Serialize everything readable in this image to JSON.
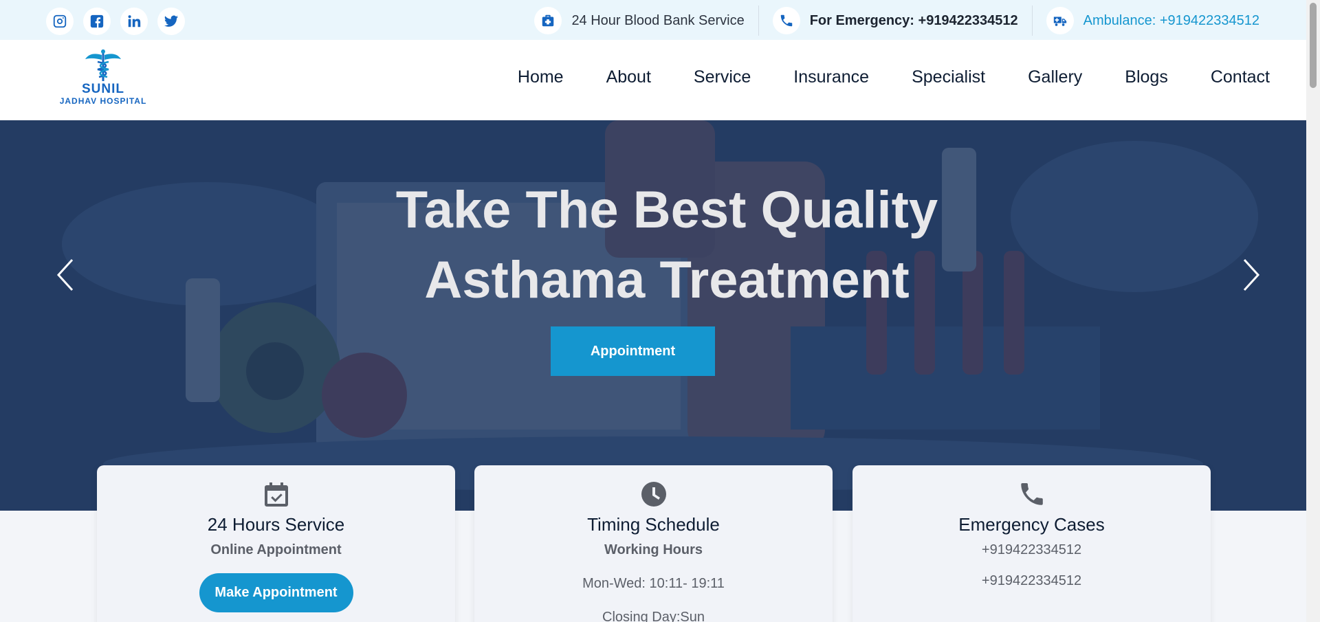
{
  "topbar": {
    "social": [
      {
        "icon": "instagram-icon"
      },
      {
        "icon": "facebook-icon"
      },
      {
        "icon": "linkedin-icon"
      },
      {
        "icon": "twitter-icon"
      }
    ],
    "blood_bank": "24 Hour Blood Bank Service",
    "emergency": "For Emergency: +919422334512",
    "ambulance": "Ambulance: +919422334512"
  },
  "logo": {
    "line1": "SUNIL",
    "line2": "JADHAV HOSPITAL"
  },
  "nav": [
    "Home",
    "About",
    "Service",
    "Insurance",
    "Specialist",
    "Gallery",
    "Blogs",
    "Contact"
  ],
  "hero": {
    "title_line1": "Take The Best Quality",
    "title_line2": "Asthama Treatment",
    "button": "Appointment"
  },
  "cards": [
    {
      "icon": "calendar-check-icon",
      "title": "24 Hours Service",
      "subtitle": "Online Appointment",
      "button": "Make Appointment"
    },
    {
      "icon": "clock-icon",
      "title": "Timing Schedule",
      "subtitle": "Working Hours",
      "line1": "Mon-Wed: 10:11- 19:11",
      "line2": "Closing Day:Sun"
    },
    {
      "icon": "phone-icon",
      "title": "Emergency Cases",
      "line1": "+919422334512",
      "line2": "+919422334512"
    }
  ],
  "colors": {
    "accent": "#1596cf",
    "brand": "#1565c0",
    "topbar_bg": "#eaf6fc",
    "hero_bg": "#2e4468"
  }
}
